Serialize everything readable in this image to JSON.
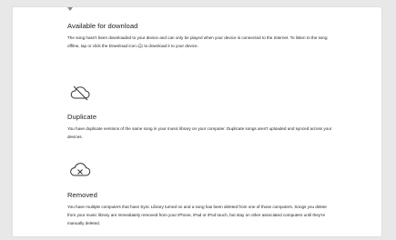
{
  "sections": [
    {
      "title": "Available for download",
      "text_before_icon": "The song hasn't been downloaded to your device and can only be played when your device is connected to the Internet. To listen to the song offline, tap or click the Download icon",
      "text_after_icon": " to download it to your device.",
      "inline_icon": "download-cloud-icon"
    },
    {
      "icon": "cloud-slash-icon",
      "title": "Duplicate",
      "text": "You have duplicate versions of the same song in your music library on your computer. Duplicate songs aren't uploaded and synced across your devices."
    },
    {
      "icon": "cloud-x-icon",
      "title": "Removed",
      "text": "You have multiple computers that have Sync Library turned on and a song has been deleted from one of those computers. Songs you delete from your music library are immediately removed from your iPhone, iPad or iPod touch, but stay on other associated computers until they're manually deleted."
    }
  ]
}
